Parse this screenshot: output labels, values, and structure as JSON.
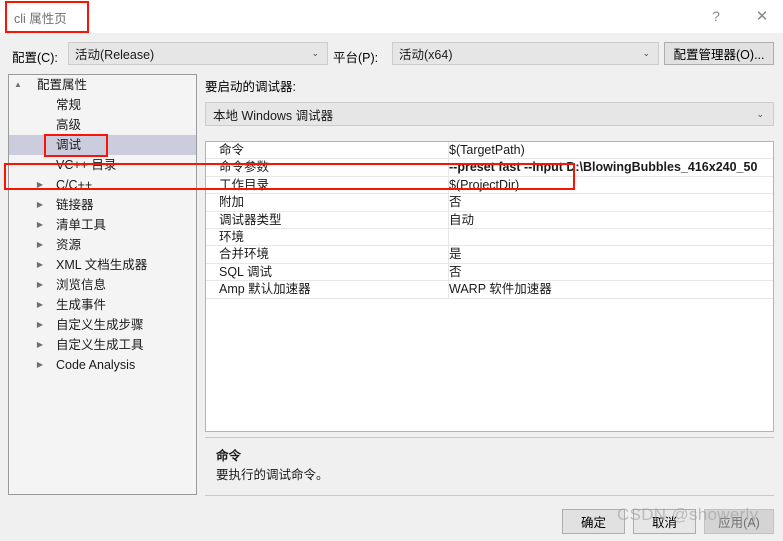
{
  "window": {
    "title": "cli 属性页",
    "help_icon": "question-mark-icon",
    "close_icon": "close-icon"
  },
  "config_bar": {
    "configuration_label": "配置(C):",
    "configuration_value": "活动(Release)",
    "platform_label": "平台(P):",
    "platform_value": "活动(x64)",
    "config_manager_button": "配置管理器(O)...",
    "chevron": "⌄"
  },
  "tree": {
    "items": [
      {
        "label": "配置属性",
        "level": 0,
        "twisty": "▲",
        "selected": false
      },
      {
        "label": "常规",
        "level": 1,
        "twisty": "",
        "selected": false
      },
      {
        "label": "高级",
        "level": 1,
        "twisty": "",
        "selected": false
      },
      {
        "label": "调试",
        "level": 1,
        "twisty": "",
        "selected": true
      },
      {
        "label": "VC++ 目录",
        "level": 1,
        "twisty": "",
        "selected": false
      },
      {
        "label": "C/C++",
        "level": 1,
        "twisty": "▶",
        "selected": false
      },
      {
        "label": "链接器",
        "level": 1,
        "twisty": "▶",
        "selected": false
      },
      {
        "label": "清单工具",
        "level": 1,
        "twisty": "▶",
        "selected": false
      },
      {
        "label": "资源",
        "level": 1,
        "twisty": "▶",
        "selected": false
      },
      {
        "label": "XML 文档生成器",
        "level": 1,
        "twisty": "▶",
        "selected": false
      },
      {
        "label": "浏览信息",
        "level": 1,
        "twisty": "▶",
        "selected": false
      },
      {
        "label": "生成事件",
        "level": 1,
        "twisty": "▶",
        "selected": false
      },
      {
        "label": "自定义生成步骤",
        "level": 1,
        "twisty": "▶",
        "selected": false
      },
      {
        "label": "自定义生成工具",
        "level": 1,
        "twisty": "▶",
        "selected": false
      },
      {
        "label": "Code Analysis",
        "level": 1,
        "twisty": "▶",
        "selected": false
      }
    ]
  },
  "main": {
    "debugger_label": "要启动的调试器:",
    "debugger_value": "本地 Windows 调试器",
    "chevron": "⌄",
    "properties": [
      {
        "name": "命令",
        "value": "$(TargetPath)",
        "highlight": false
      },
      {
        "name": "命令参数",
        "value": "--preset fast --input D:\\BlowingBubbles_416x240_50",
        "highlight": true
      },
      {
        "name": "工作目录",
        "value": "$(ProjectDir)",
        "highlight": false
      },
      {
        "name": "附加",
        "value": "否",
        "highlight": false
      },
      {
        "name": "调试器类型",
        "value": "自动",
        "highlight": false
      },
      {
        "name": "环境",
        "value": "",
        "highlight": false
      },
      {
        "name": "合并环境",
        "value": "是",
        "highlight": false
      },
      {
        "name": "SQL 调试",
        "value": "否",
        "highlight": false
      },
      {
        "name": "Amp 默认加速器",
        "value": "WARP 软件加速器",
        "highlight": false
      }
    ],
    "description": {
      "title": "命令",
      "body": "要执行的调试命令。"
    }
  },
  "footer": {
    "ok": "确定",
    "cancel": "取消",
    "apply": "应用(A)"
  },
  "watermark": {
    "text": "CSDN @showerly"
  },
  "colors": {
    "highlight_red": "#fa1405",
    "tree_selection": "#ccccdf",
    "dialog_background": "#f0f0f0",
    "grid_background": "#ffffff"
  }
}
